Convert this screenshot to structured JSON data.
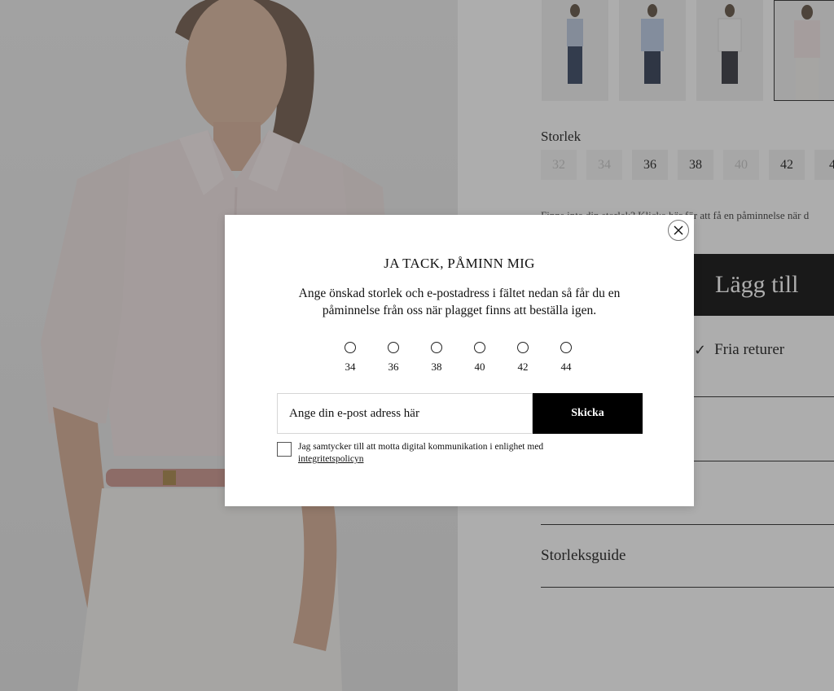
{
  "product": {
    "size_title": "Storlek",
    "sizes": [
      {
        "label": "32",
        "available": false
      },
      {
        "label": "34",
        "available": false
      },
      {
        "label": "36",
        "available": true
      },
      {
        "label": "38",
        "available": true
      },
      {
        "label": "40",
        "available": false
      },
      {
        "label": "42",
        "available": true
      },
      {
        "label": "4",
        "available": true
      }
    ],
    "remind_text": "Finns inte din storlek? Klicka här för att få en påminnelse när d",
    "add_button": "Lägg till",
    "returns": "Fria returer",
    "size_guide": "Storleksguide"
  },
  "modal": {
    "title": "JA TACK, PÅMINN MIG",
    "description": "Ange önskad storlek och e-postadress i fältet nedan så får du en påminnelse från oss när plagget finns att beställa igen.",
    "size_options": [
      "34",
      "36",
      "38",
      "40",
      "42",
      "44"
    ],
    "email_placeholder": "Ange din e-post adress här",
    "send_label": "Skicka",
    "consent_text": "Jag samtycker till att motta digital kommunikation i enlighet med",
    "consent_link": "integritetspolicyn"
  },
  "icons": {
    "close": "close-icon",
    "check": "checkmark-icon"
  },
  "colors": {
    "button": "#000000",
    "overlay": "rgba(60,60,60,0.42)"
  }
}
